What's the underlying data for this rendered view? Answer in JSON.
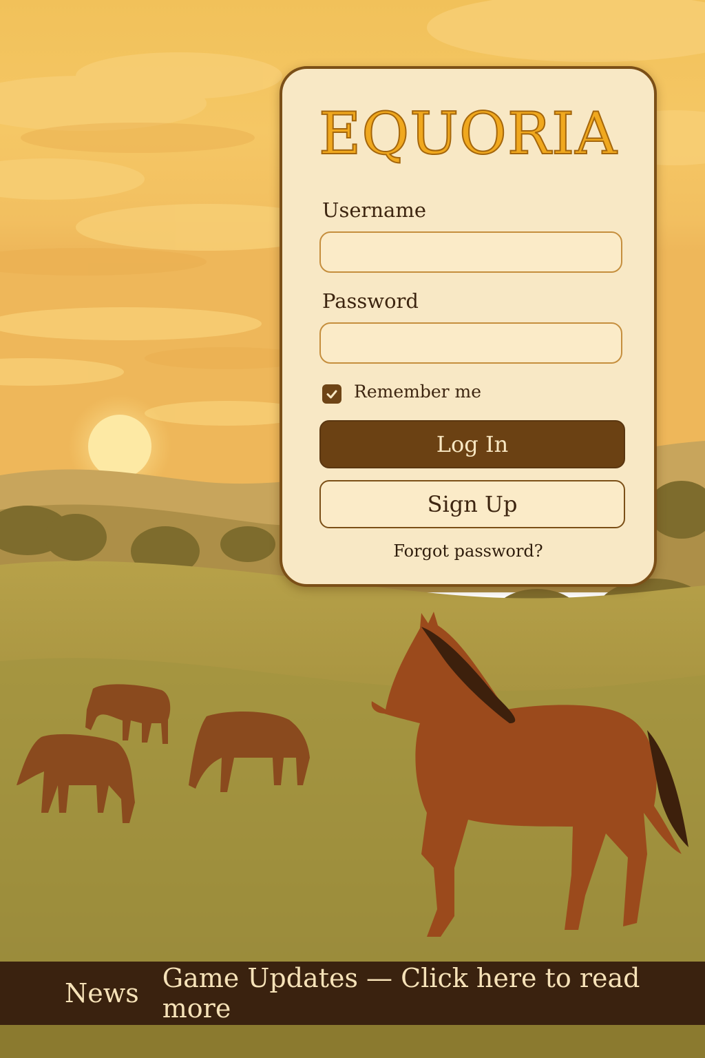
{
  "app": {
    "title": "EQUORIA"
  },
  "login": {
    "username_label": "Username",
    "username_value": "",
    "password_label": "Password",
    "password_value": "",
    "remember_label": "Remember me",
    "remember_checked": true,
    "login_button": "Log In",
    "signup_button": "Sign Up",
    "forgot_link": "Forgot password?"
  },
  "news": {
    "label": "News",
    "text": "Game Updates — Click here to read more"
  },
  "colors": {
    "brand": "#f0a81e",
    "primary_button": "#6b4113",
    "card_background": "#f8e8c5",
    "news_bar": "#3a220f"
  },
  "icons": {
    "checkbox": "checkmark-icon"
  }
}
